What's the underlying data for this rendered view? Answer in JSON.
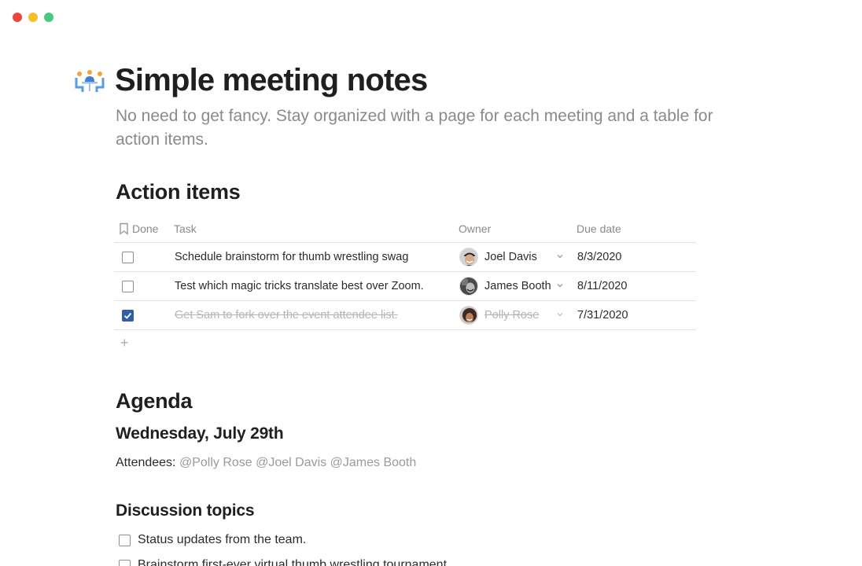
{
  "window": {
    "controls": [
      "close",
      "minimize",
      "maximize"
    ],
    "colors": {
      "close": "#e9473f",
      "minimize": "#f5bf2b",
      "maximize": "#48c97f"
    }
  },
  "page": {
    "icon": "meeting-table-icon",
    "title": "Simple meeting notes",
    "description": "No need to get fancy. Stay organized with a page for each meeting and a table for action items."
  },
  "action_items": {
    "heading": "Action items",
    "columns": {
      "done": "Done",
      "task": "Task",
      "owner": "Owner",
      "due": "Due date"
    },
    "rows": [
      {
        "done": false,
        "task": "Schedule brainstorm for thumb wrestling swag",
        "owner": "Joel Davis",
        "due": "8/3/2020"
      },
      {
        "done": false,
        "task": "Test which magic tricks translate best over Zoom.",
        "owner": "James Booth",
        "due": "8/11/2020"
      },
      {
        "done": true,
        "task": "Get Sam to fork over the event attendee list.",
        "owner": "Polly Rose",
        "due": "7/31/2020"
      }
    ],
    "add_label": "+",
    "accent_color": "#2f5ea8"
  },
  "agenda": {
    "heading": "Agenda",
    "date_heading": "Wednesday, July 29th",
    "attendees_label": "Attendees:",
    "attendees": [
      "@Polly Rose",
      "@Joel Davis",
      "@James Booth"
    ]
  },
  "discussion": {
    "heading": "Discussion topics",
    "items": [
      {
        "checked": false,
        "text": "Status updates from the team."
      },
      {
        "checked": false,
        "text": "Brainstorm first-ever virtual thumb wrestling tournament."
      }
    ]
  }
}
